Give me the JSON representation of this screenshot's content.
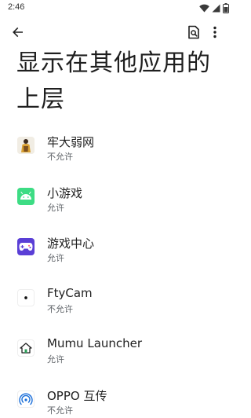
{
  "status_bar": {
    "time": "2:46",
    "icons": [
      "wifi-icon",
      "signal-icon",
      "battery-icon"
    ]
  },
  "app_bar": {
    "back_icon": "arrow-back-icon",
    "search_icon": "search-settings-icon",
    "more_icon": "more-vert-icon"
  },
  "page": {
    "title": "显示在其他应用的上层"
  },
  "apps": [
    {
      "name": "牢大弱网",
      "status": "不允许",
      "icon": "ladarou-app-icon"
    },
    {
      "name": "小游戏",
      "status": "允许",
      "icon": "android-app-icon"
    },
    {
      "name": "游戏中心",
      "status": "允许",
      "icon": "gamepad-app-icon"
    },
    {
      "name": "FtyCam",
      "status": "不允许",
      "icon": "ftycam-app-icon"
    },
    {
      "name": "Mumu Launcher",
      "status": "允许",
      "icon": "home-app-icon"
    },
    {
      "name": "OPPO 互传",
      "status": "不允许",
      "icon": "oppo-share-app-icon"
    }
  ],
  "colors": {
    "background": "#ffffff",
    "text_primary": "#1f1f1f",
    "text_secondary": "#5f6368",
    "android_green": "#3ddc84",
    "game_center_purple": "#5a3fd6"
  }
}
